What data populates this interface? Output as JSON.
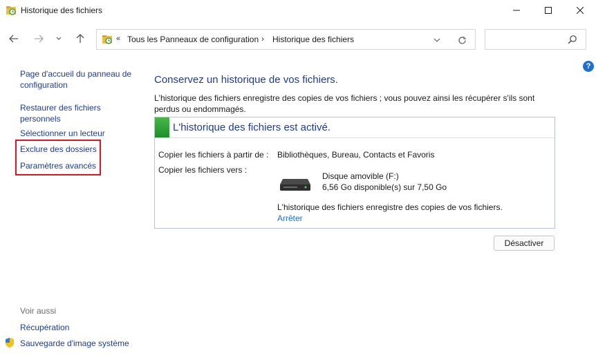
{
  "window": {
    "title": "Historique des fichiers"
  },
  "icons": {
    "app": "file-history-icon",
    "shield": "uac-shield-icon",
    "help": "help-icon",
    "search": "search-icon"
  },
  "address": {
    "overflow_chevron": "«",
    "crumb1": "Tous les Panneaux de configuration",
    "separator": "›",
    "crumb2": "Historique des fichiers"
  },
  "search": {
    "placeholder": ""
  },
  "sidebar": {
    "home": "Page d'accueil du panneau de configuration",
    "restore": "Restaurer des fichiers personnels",
    "select_drive": "Sélectionner un lecteur",
    "exclude": "Exclure des dossiers",
    "advanced": "Paramètres avancés",
    "see_also": "Voir aussi",
    "recovery": "Récupération",
    "backup_image": "Sauvegarde d'image système"
  },
  "main": {
    "title": "Conservez un historique de vos fichiers.",
    "description": "L'historique des fichiers enregistre des copies de vos fichiers ; vous pouvez ainsi les récupérer s'ils sont perdus ou endommagés.",
    "panel": {
      "status": "L'historique des fichiers est activé.",
      "copy_from_label": "Copier les fichiers à partir de :",
      "copy_from_value": "Bibliothèques, Bureau, Contacts et Favoris",
      "copy_to_label": "Copier les fichiers vers :",
      "drive_name": "Disque amovible (F:)",
      "drive_space": "6,56 Go disponible(s) sur 7,50 Go",
      "note": "L'historique des fichiers enregistre des copies de vos fichiers.",
      "stop_link": "Arrêter"
    },
    "deactivate_button": "Désactiver"
  },
  "colors": {
    "link": "#1d3c8f",
    "accent": "#1d6fd1",
    "status_green": "#2e9e3a",
    "highlight": "#e0141e"
  }
}
